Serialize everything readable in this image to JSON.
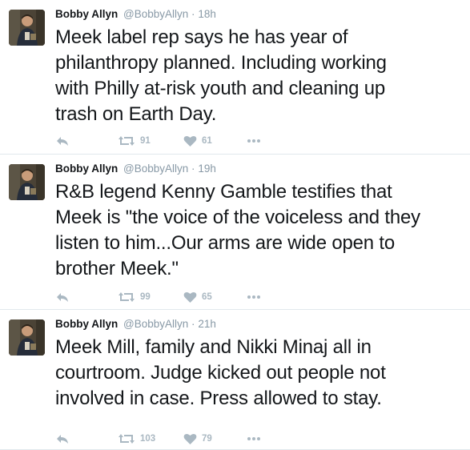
{
  "tweets": [
    {
      "name": "Bobby Allyn",
      "handle": "@BobbyAllyn",
      "dot": "·",
      "time": "18h",
      "text_lines": [
        "Meek label rep says he has year of",
        "philanthropy planned. Including working",
        "with Philly at-risk youth and cleaning up",
        "trash on Earth Day."
      ],
      "retweets": "91",
      "likes": "61"
    },
    {
      "name": "Bobby Allyn",
      "handle": "@BobbyAllyn",
      "dot": "·",
      "time": "19h",
      "text_lines": [
        "R&B legend Kenny Gamble testifies that",
        "Meek is \"the voice of the voiceless and they",
        "listen to him...Our arms are wide open to",
        "brother Meek.\""
      ],
      "retweets": "99",
      "likes": "65"
    },
    {
      "name": "Bobby Allyn",
      "handle": "@BobbyAllyn",
      "dot": "·",
      "time": "21h",
      "text_lines": [
        "Meek Mill, family and Nikki Minaj all in",
        "courtroom. Judge kicked out people not",
        "involved in case. Press allowed to stay."
      ],
      "retweets": "103",
      "likes": "79"
    }
  ],
  "icons": {
    "reply": "reply-icon",
    "retweet": "retweet-icon",
    "like": "heart-icon",
    "more": "more-icon"
  },
  "colors": {
    "text": "#14171a",
    "secondary": "#8899a6",
    "action_icon": "#aab8c2",
    "divider": "#e1e8ed"
  }
}
